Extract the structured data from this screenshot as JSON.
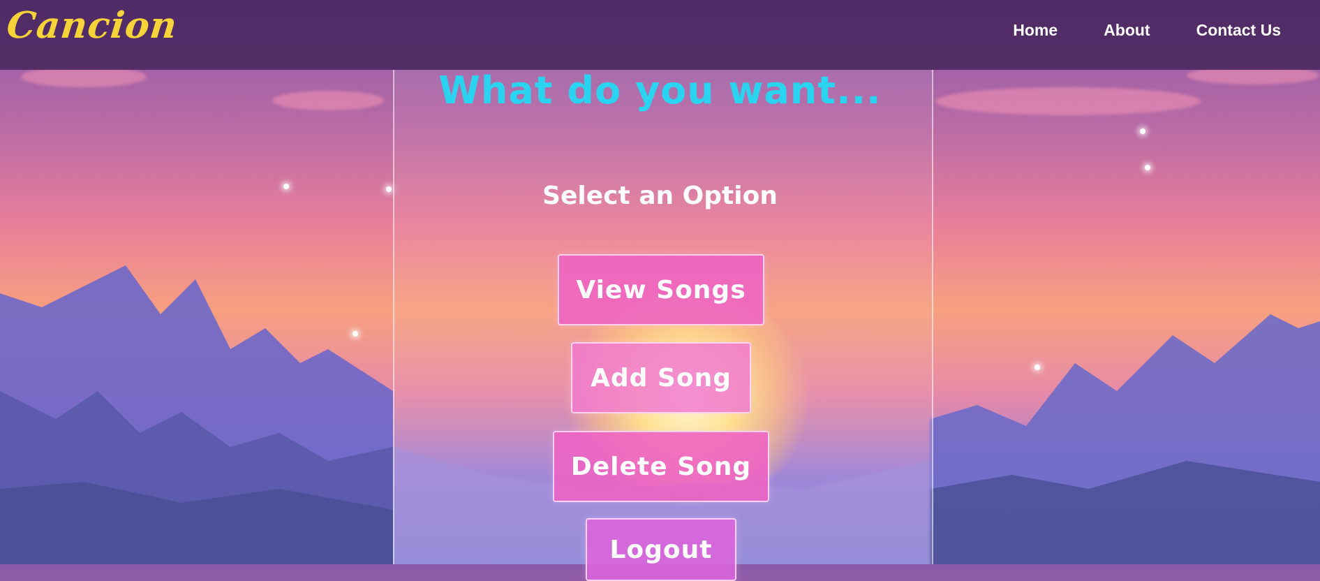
{
  "header": {
    "logo": "Cancion",
    "nav": [
      "Home",
      "About",
      "Contact Us"
    ]
  },
  "main": {
    "headline": "What do you want...",
    "subheading": "Select an Option",
    "buttons": {
      "view_songs": "View Songs",
      "add_song": "Add Song",
      "delete_song": "Delete Song",
      "logout": "Logout"
    }
  },
  "colors": {
    "logo": "#f7d33a",
    "headline": "#2ad4f0",
    "button": "#ee62c4",
    "header_bg": "#48265c"
  }
}
